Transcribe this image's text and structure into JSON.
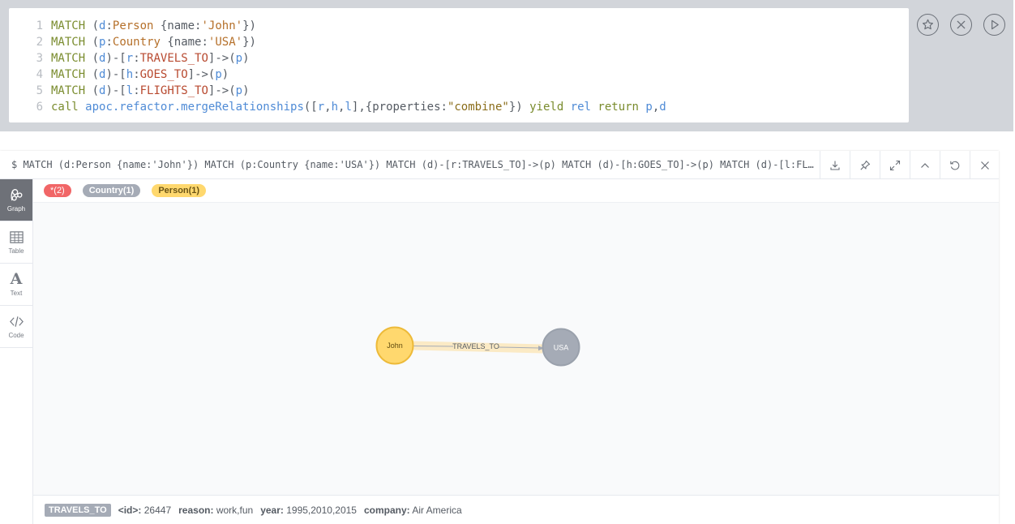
{
  "editor": {
    "lines": [
      {
        "n": "1",
        "tokens": [
          [
            "kw",
            "MATCH "
          ],
          [
            "punc",
            "("
          ],
          [
            "var",
            "d"
          ],
          [
            "punc",
            ":"
          ],
          [
            "label",
            "Person"
          ],
          [
            "punc",
            " {"
          ],
          [
            "key",
            "name"
          ],
          [
            "punc",
            ":"
          ],
          [
            "str",
            "'John'"
          ],
          [
            "punc",
            "})"
          ]
        ]
      },
      {
        "n": "2",
        "tokens": [
          [
            "kw",
            "MATCH "
          ],
          [
            "punc",
            "("
          ],
          [
            "var",
            "p"
          ],
          [
            "punc",
            ":"
          ],
          [
            "label",
            "Country"
          ],
          [
            "punc",
            " {"
          ],
          [
            "key",
            "name"
          ],
          [
            "punc",
            ":"
          ],
          [
            "str",
            "'USA'"
          ],
          [
            "punc",
            "})"
          ]
        ]
      },
      {
        "n": "3",
        "tokens": [
          [
            "kw",
            "MATCH "
          ],
          [
            "punc",
            "("
          ],
          [
            "var",
            "d"
          ],
          [
            "punc",
            ")-["
          ],
          [
            "var",
            "r"
          ],
          [
            "punc",
            ":"
          ],
          [
            "rel",
            "TRAVELS_TO"
          ],
          [
            "punc",
            "]->("
          ],
          [
            "var",
            "p"
          ],
          [
            "punc",
            ")"
          ]
        ]
      },
      {
        "n": "4",
        "tokens": [
          [
            "kw",
            "MATCH "
          ],
          [
            "punc",
            "("
          ],
          [
            "var",
            "d"
          ],
          [
            "punc",
            ")-["
          ],
          [
            "var",
            "h"
          ],
          [
            "punc",
            ":"
          ],
          [
            "rel",
            "GOES_TO"
          ],
          [
            "punc",
            "]->("
          ],
          [
            "var",
            "p"
          ],
          [
            "punc",
            ")"
          ]
        ]
      },
      {
        "n": "5",
        "tokens": [
          [
            "kw",
            "MATCH "
          ],
          [
            "punc",
            "("
          ],
          [
            "var",
            "d"
          ],
          [
            "punc",
            ")-["
          ],
          [
            "var",
            "l"
          ],
          [
            "punc",
            ":"
          ],
          [
            "rel",
            "FLIGHTS_TO"
          ],
          [
            "punc",
            "]->("
          ],
          [
            "var",
            "p"
          ],
          [
            "punc",
            ")"
          ]
        ]
      },
      {
        "n": "6",
        "tokens": [
          [
            "kw",
            "call "
          ],
          [
            "fn",
            "apoc.refactor.mergeRelationships"
          ],
          [
            "punc",
            "(["
          ],
          [
            "var",
            "r"
          ],
          [
            "punc",
            ","
          ],
          [
            "var",
            "h"
          ],
          [
            "punc",
            ","
          ],
          [
            "var",
            "l"
          ],
          [
            "punc",
            "],{"
          ],
          [
            "key",
            "properties"
          ],
          [
            "punc",
            ":"
          ],
          [
            "strq",
            "\"combine\""
          ],
          [
            "punc",
            "}) "
          ],
          [
            "kw",
            "yield "
          ],
          [
            "fn",
            "rel "
          ],
          [
            "kw",
            "return "
          ],
          [
            "fn",
            "p"
          ],
          [
            "punc",
            ","
          ],
          [
            "fn",
            "d"
          ]
        ]
      }
    ],
    "actions": [
      "star-icon",
      "close-circle-icon",
      "play-icon"
    ]
  },
  "frame": {
    "title": "$ MATCH (d:Person {name:'John'}) MATCH (p:Country {name:'USA'}) MATCH (d)-[r:TRAVELS_TO]->(p) MATCH (d)-[h:GOES_TO]->(p) MATCH (d)-[l:FLIGHTS_TO]->(p) call apoc.refactor.mergeRelationships([r,h,l],{properties:\"combine\"}) yield rel return p,d",
    "tools": [
      "download-icon",
      "pin-icon",
      "expand-icon",
      "collapse-icon",
      "rerun-icon",
      "close-icon"
    ]
  },
  "views": [
    {
      "id": "graph",
      "label": "Graph",
      "icon": "graph-icon",
      "active": true
    },
    {
      "id": "table",
      "label": "Table",
      "icon": "table-icon",
      "active": false
    },
    {
      "id": "text",
      "label": "Text",
      "icon": "text-icon",
      "active": false
    },
    {
      "id": "code",
      "label": "Code",
      "icon": "code-icon",
      "active": false
    }
  ],
  "legend": {
    "all": "*(2)",
    "country": "Country(1)",
    "person": "Person(1)"
  },
  "graph": {
    "nodes": [
      {
        "id": "john",
        "label": "John",
        "type": "Person",
        "color": "#ffd86e",
        "stroke": "#edba39",
        "text": "#604a0e"
      },
      {
        "id": "usa",
        "label": "USA",
        "type": "Country",
        "color": "#a5abb6",
        "stroke": "#9aa1ac",
        "text": "#ffffff"
      }
    ],
    "relationship": {
      "label": "TRAVELS_TO",
      "highlight": "#fbe9c2"
    }
  },
  "details": {
    "type": "TRAVELS_TO",
    "props": [
      {
        "key": "<id>:",
        "value": "26447"
      },
      {
        "key": "reason:",
        "value": "work,fun"
      },
      {
        "key": "year:",
        "value": "1995,2010,2015"
      },
      {
        "key": "company:",
        "value": "Air America"
      }
    ]
  }
}
